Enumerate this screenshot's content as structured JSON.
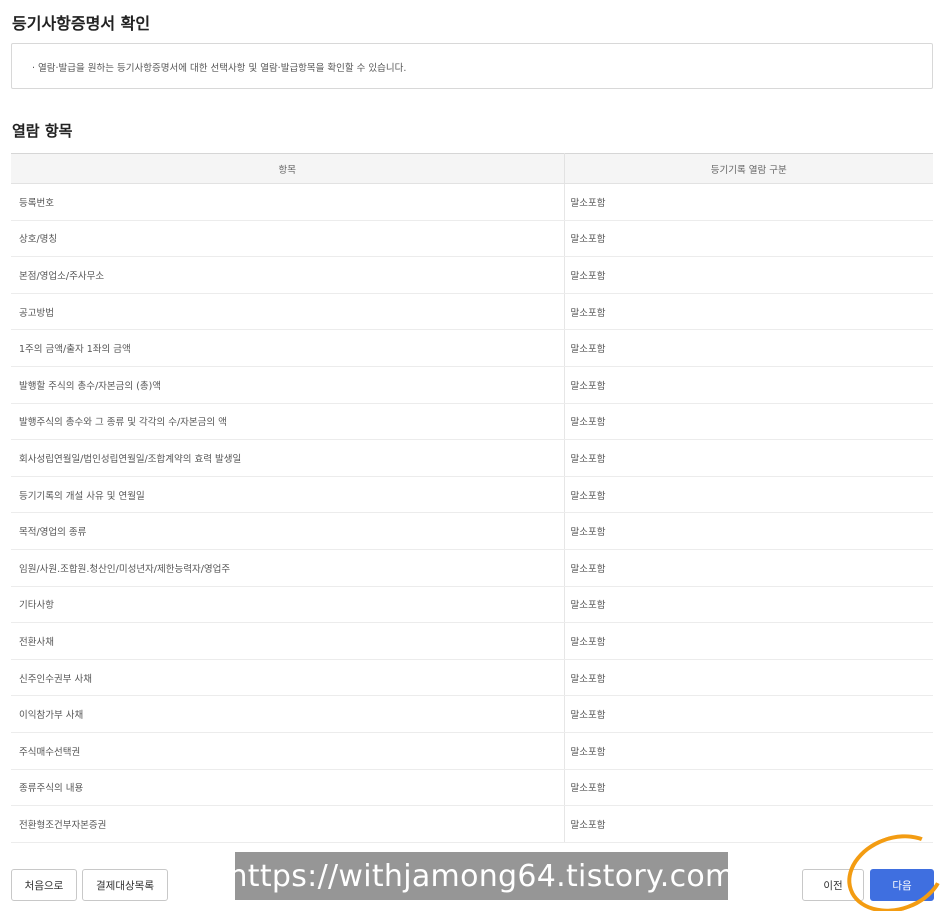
{
  "page": {
    "title": "등기사항증명서 확인",
    "notice": "· 열람·발급을 원하는 등기사항증명서에 대한 선택사항 및 열람·발급항목을 확인할 수 있습니다."
  },
  "section": {
    "title": "열람 항목"
  },
  "table": {
    "headers": [
      "항목",
      "등기기록 열람 구분"
    ],
    "rows": [
      {
        "item": "등록번호",
        "value": "말소포함"
      },
      {
        "item": "상호/명칭",
        "value": "말소포함"
      },
      {
        "item": "본점/영업소/주사무소",
        "value": "말소포함"
      },
      {
        "item": "공고방법",
        "value": "말소포함"
      },
      {
        "item": "1주의 금액/출자 1좌의 금액",
        "value": "말소포함"
      },
      {
        "item": "발행할 주식의 총수/자본금의 (총)액",
        "value": "말소포함"
      },
      {
        "item": "발행주식의 총수와 그 종류 및 각각의 수/자본금의 액",
        "value": "말소포함"
      },
      {
        "item": "회사성립연월일/법인성립연월일/조합계약의 효력 발생일",
        "value": "말소포함"
      },
      {
        "item": "등기기록의 개설 사유 및 연월일",
        "value": "말소포함"
      },
      {
        "item": "목적/영업의 종류",
        "value": "말소포함"
      },
      {
        "item": "임원/사원.조합원.청산인/미성년자/제한능력자/영업주",
        "value": "말소포함"
      },
      {
        "item": "기타사항",
        "value": "말소포함"
      },
      {
        "item": "전환사채",
        "value": "말소포함"
      },
      {
        "item": "신주인수권부 사채",
        "value": "말소포함"
      },
      {
        "item": "이익참가부 사채",
        "value": "말소포함"
      },
      {
        "item": "주식매수선택권",
        "value": "말소포함"
      },
      {
        "item": "종류주식의 내용",
        "value": "말소포함"
      },
      {
        "item": "전환형조건부자본증권",
        "value": "말소포함"
      }
    ]
  },
  "buttons": {
    "first": "처음으로",
    "payment_list": "결제대상목록",
    "prev": "이전",
    "next": "다음"
  },
  "watermark": "https://withjamong64.tistory.com",
  "colors": {
    "primary": "#3f6fe0",
    "highlight": "#f39c12"
  }
}
